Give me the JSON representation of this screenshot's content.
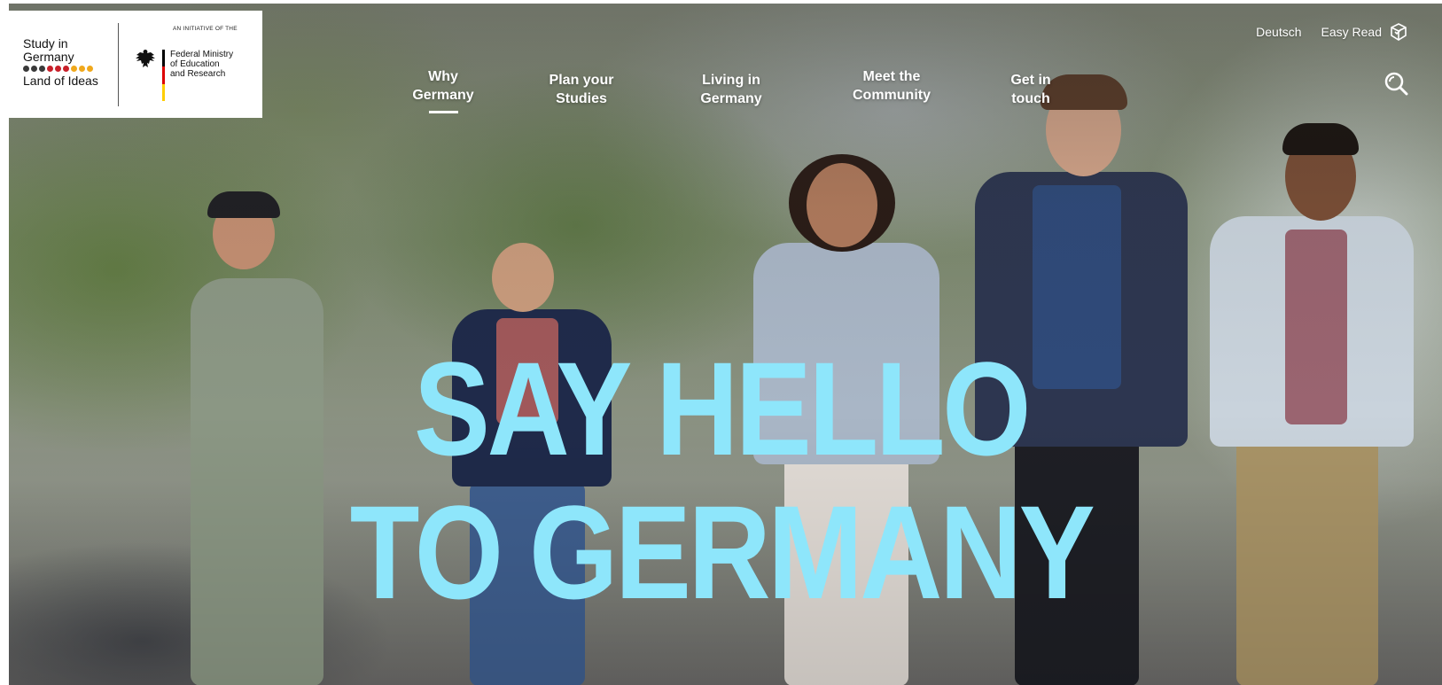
{
  "logo": {
    "line1": "Study in",
    "line2": "Germany",
    "tagline": "Land of Ideas",
    "dot_colors": [
      "#3a3a3a",
      "#3a3a3a",
      "#3a3a3a",
      "#c8202a",
      "#c8202a",
      "#c8202a",
      "#f0a81c",
      "#f0a81c",
      "#f0a81c"
    ],
    "initiative": "AN INITIATIVE OF THE",
    "ministry_line1": "Federal Ministry",
    "ministry_line2": "of Education",
    "ministry_line3": "and Research",
    "flag_colors": [
      "#000000",
      "#dd0000",
      "#ffce00"
    ]
  },
  "nav": {
    "items": [
      {
        "line1": "Why",
        "line2": "Germany",
        "active": true
      },
      {
        "line1": "Plan your",
        "line2": "Studies",
        "active": false
      },
      {
        "line1": "Living in",
        "line2": "Germany",
        "active": false
      },
      {
        "line1": "Meet the",
        "line2": "Community",
        "active": false
      },
      {
        "line1": "Get in",
        "line2": "touch",
        "active": false
      }
    ]
  },
  "top_links": {
    "language": "Deutsch",
    "easy_read": "Easy Read",
    "easy_read_icon": "easy-read-icon"
  },
  "search": {
    "icon": "search-icon"
  },
  "hero": {
    "headline_line1": "SAY HELLO",
    "headline_line2": "TO GERMANY",
    "headline_color": "#8ee6fb"
  }
}
